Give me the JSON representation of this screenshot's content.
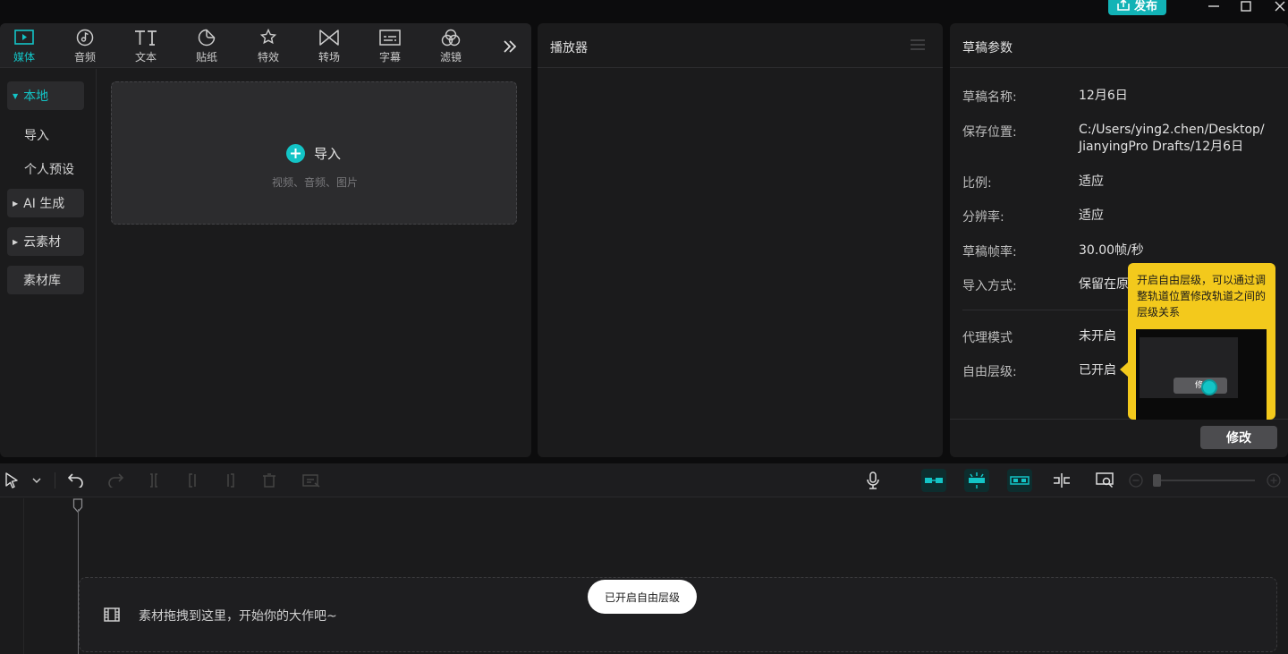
{
  "titlebar": {
    "publish_label": "发布",
    "window_controls": [
      "minimize-icon",
      "maximize-icon",
      "close-icon"
    ]
  },
  "media_panel": {
    "tabs": [
      {
        "label": "媒体",
        "icon": "media-icon",
        "active": true
      },
      {
        "label": "音频",
        "icon": "audio-icon"
      },
      {
        "label": "文本",
        "icon": "text-icon"
      },
      {
        "label": "贴纸",
        "icon": "sticker-icon"
      },
      {
        "label": "特效",
        "icon": "effects-icon"
      },
      {
        "label": "转场",
        "icon": "transition-icon"
      },
      {
        "label": "字幕",
        "icon": "caption-icon"
      },
      {
        "label": "滤镜",
        "icon": "filter-icon"
      }
    ],
    "sidebar": {
      "local": "本地",
      "import": "导入",
      "preset": "个人预设",
      "ai": "AI 生成",
      "cloud": "云素材",
      "library": "素材库"
    },
    "import_box": {
      "label": "导入",
      "hint": "视频、音频、图片"
    }
  },
  "player": {
    "title": "播放器"
  },
  "draft_params": {
    "title": "草稿参数",
    "rows": [
      {
        "label": "草稿名称:",
        "value": "12月6日"
      },
      {
        "label": "保存位置:",
        "value_line1": "C:/Users/ying2.chen/Desktop/",
        "value_line2": "JianyingPro Drafts/12月6日"
      },
      {
        "label": "比例:",
        "value": "适应"
      },
      {
        "label": "分辨率:",
        "value": "适应"
      },
      {
        "label": "草稿帧率:",
        "value": "30.00帧/秒"
      },
      {
        "label": "导入方式:",
        "value": "保留在原"
      },
      {
        "label": "代理模式",
        "value": "未开启"
      },
      {
        "label": "自由层级:",
        "value": "已开启"
      }
    ],
    "modify_label": "修改"
  },
  "tooltip": {
    "text": "开启自由层级，可以通过调整轨道位置修改轨道之间的层级关系",
    "preview_button": "修"
  },
  "timeline": {
    "toast": "已开启自由层级",
    "drop_hint": "素材拖拽到这里，开始你的大作吧~",
    "zoom_level": 0
  },
  "colors": {
    "accent": "#13c4c6",
    "tooltip": "#f3c91c",
    "panel": "#1b1b1c"
  }
}
